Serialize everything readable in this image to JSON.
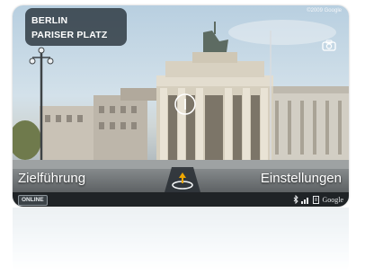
{
  "location": {
    "city": "BERLIN",
    "place": "PARISER PLATZ"
  },
  "copyright": "©2009 Google",
  "bottom_bar": {
    "route_label": "Zielführung",
    "settings_label": "Einstellungen"
  },
  "status_bar": {
    "online_label": "ONLINE",
    "brand": "Google"
  },
  "icons": {
    "camera": "camera-icon",
    "center": "map-pin-icon",
    "bluetooth": "bluetooth-icon",
    "signal": "signal-icon",
    "gps": "gps-icon"
  },
  "colors": {
    "overlay": "#232d34",
    "accent": "#f0a800",
    "status_bar": "#1f2326"
  }
}
